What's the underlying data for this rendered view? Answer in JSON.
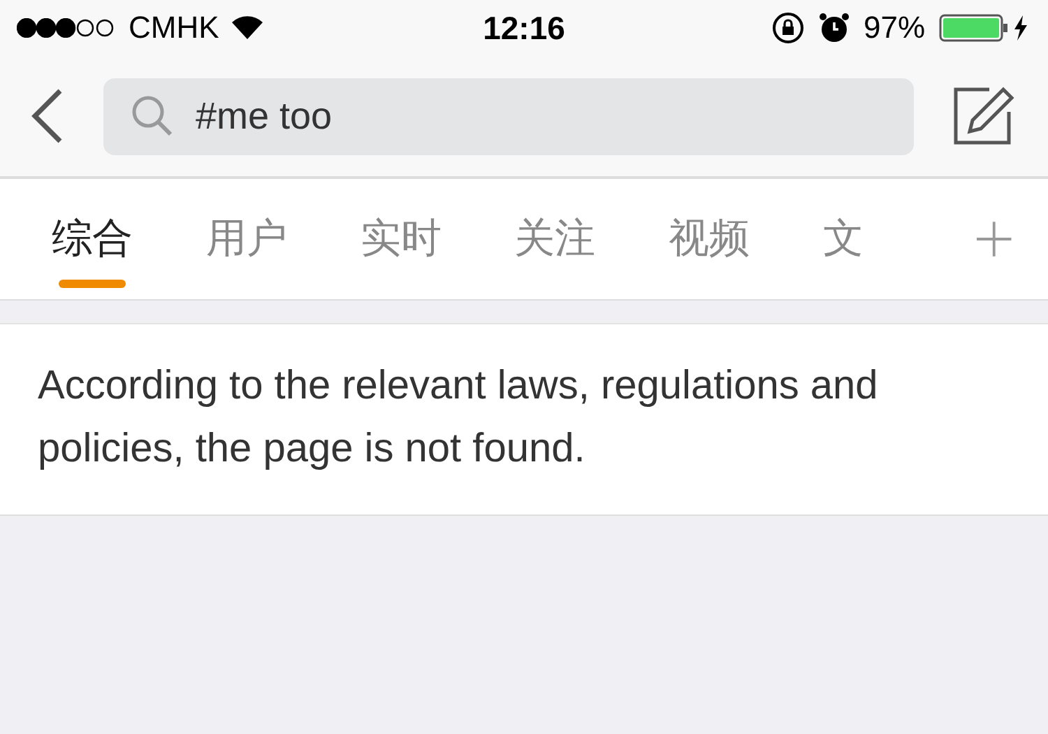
{
  "status_bar": {
    "carrier": "CMHK",
    "time": "12:16",
    "battery": "97%"
  },
  "search": {
    "value": "#me too"
  },
  "tabs": [
    {
      "label": "综合",
      "selected": true
    },
    {
      "label": "用户",
      "selected": false
    },
    {
      "label": "实时",
      "selected": false
    },
    {
      "label": "关注",
      "selected": false
    },
    {
      "label": "视频",
      "selected": false
    },
    {
      "label": "文",
      "selected": false
    }
  ],
  "message": "According to the relevant laws, regulations and policies, the page is not found."
}
